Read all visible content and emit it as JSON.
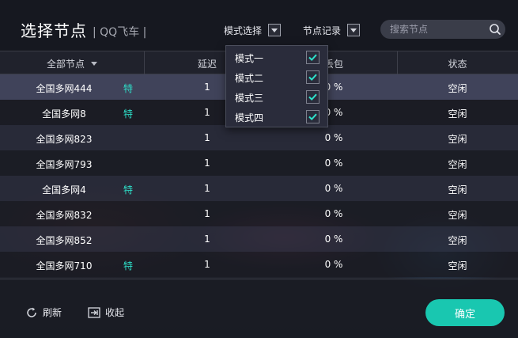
{
  "header": {
    "title": "选择节点",
    "subtitle": "| QQ飞车 |",
    "mode_select_label": "模式选择",
    "node_record_label": "节点记录",
    "search_placeholder": "搜索节点"
  },
  "table": {
    "columns": {
      "node": "全部节点",
      "delay": "延迟",
      "loss": "丢包",
      "status": "状态"
    },
    "rows": [
      {
        "name": "全国多网444",
        "tag": "特",
        "delay": "1",
        "loss": "0 %",
        "status": "空闲"
      },
      {
        "name": "全国多网8",
        "tag": "特",
        "delay": "1",
        "loss": "0 %",
        "status": "空闲"
      },
      {
        "name": "全国多网823",
        "tag": "",
        "delay": "1",
        "loss": "0 %",
        "status": "空闲"
      },
      {
        "name": "全国多网793",
        "tag": "",
        "delay": "1",
        "loss": "0 %",
        "status": "空闲"
      },
      {
        "name": "全国多网4",
        "tag": "特",
        "delay": "1",
        "loss": "0 %",
        "status": "空闲"
      },
      {
        "name": "全国多网832",
        "tag": "",
        "delay": "1",
        "loss": "0 %",
        "status": "空闲"
      },
      {
        "name": "全国多网852",
        "tag": "",
        "delay": "1",
        "loss": "0 %",
        "status": "空闲"
      },
      {
        "name": "全国多网710",
        "tag": "特",
        "delay": "1",
        "loss": "0 %",
        "status": "空闲"
      }
    ]
  },
  "mode_dropdown": {
    "items": [
      {
        "label": "模式一",
        "checked": true
      },
      {
        "label": "模式二",
        "checked": true
      },
      {
        "label": "模式三",
        "checked": true
      },
      {
        "label": "模式四",
        "checked": true
      }
    ]
  },
  "footer": {
    "refresh_label": "刷新",
    "collapse_label": "收起",
    "confirm_label": "确定"
  },
  "colors": {
    "accent": "#19c7b0",
    "tag": "#2ee0c9",
    "check": "#2ee0c9"
  }
}
